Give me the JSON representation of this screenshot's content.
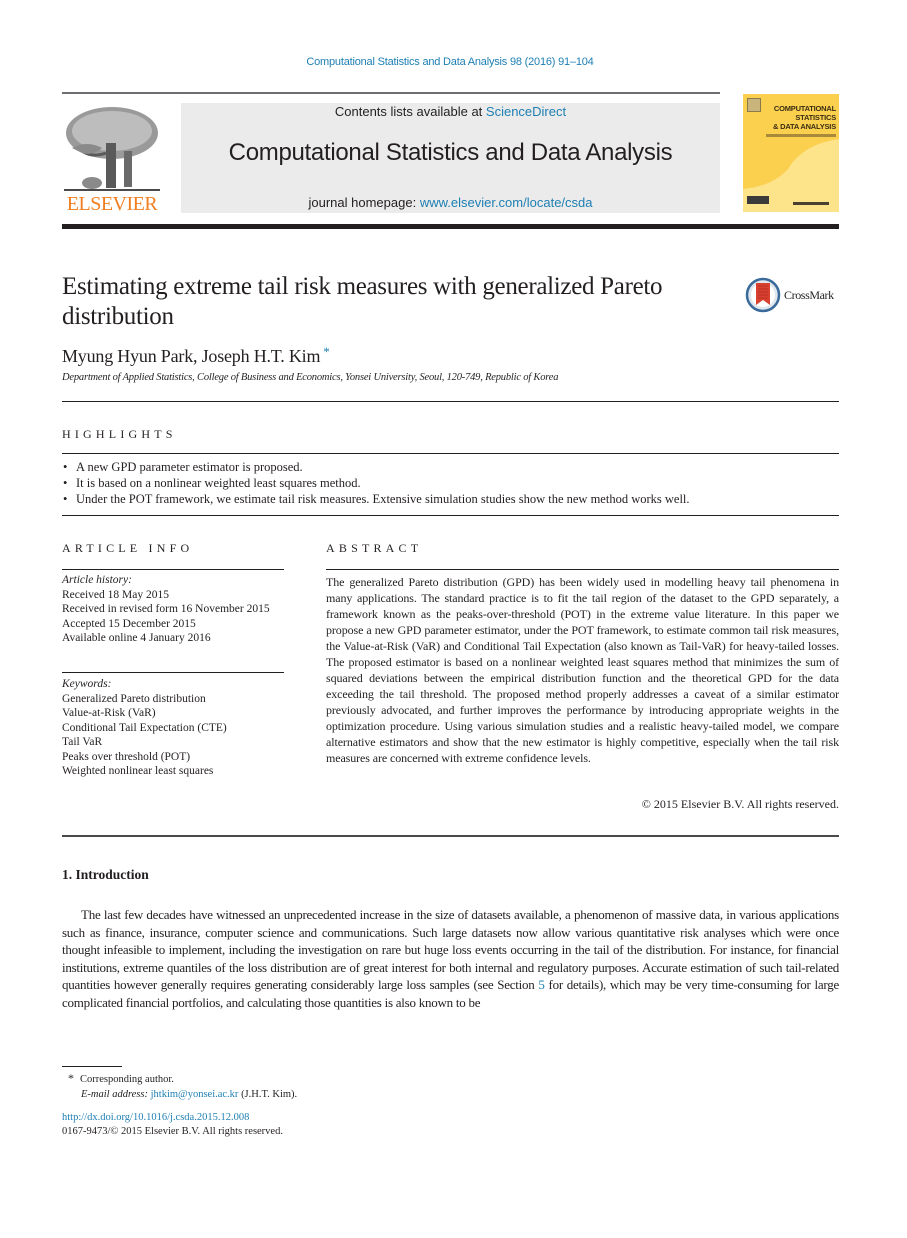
{
  "running_header": {
    "citation": "Computational Statistics and Data Analysis 98 (2016) 91–104"
  },
  "journal_banner": {
    "publisher": "ELSEVIER",
    "contents_prefix": "Contents lists available at ",
    "contents_link": "ScienceDirect",
    "journal_title": "Computational Statistics and Data Analysis",
    "homepage_prefix": "journal homepage: ",
    "homepage_link": "www.elsevier.com/locate/csda",
    "cover_title_lines": [
      "COMPUTATIONAL",
      "STATISTICS",
      "& DATA ANALYSIS"
    ],
    "cover_color": "#fbd04f"
  },
  "article": {
    "title": "Estimating extreme tail risk measures with generalized Pareto distribution",
    "crossmark_label": "CrossMark",
    "authors": "Myung Hyun Park, Joseph H.T. Kim",
    "corresponding_mark": "*",
    "affiliation": "Department of Applied Statistics, College of Business and Economics, Yonsei University, Seoul, 120-749, Republic of Korea"
  },
  "highlights": {
    "heading": "HIGHLIGHTS",
    "items": [
      "A new GPD parameter estimator is proposed.",
      "It is based on a nonlinear weighted least squares method.",
      "Under the POT framework, we estimate tail risk measures. Extensive simulation studies show the new method works well."
    ]
  },
  "article_info": {
    "heading": "ARTICLE INFO",
    "history_label": "Article history:",
    "history": [
      "Received 18 May 2015",
      "Received in revised form 16 November 2015",
      "Accepted 15 December 2015",
      "Available online 4 January 2016"
    ],
    "keywords_label": "Keywords:",
    "keywords": [
      "Generalized Pareto distribution",
      "Value-at-Risk (VaR)",
      "Conditional Tail Expectation (CTE)",
      "Tail VaR",
      "Peaks over threshold (POT)",
      "Weighted nonlinear least squares"
    ]
  },
  "abstract": {
    "heading": "ABSTRACT",
    "text": "The generalized Pareto distribution (GPD) has been widely used in modelling heavy tail phenomena in many applications. The standard practice is to fit the tail region of the dataset to the GPD separately, a framework known as the peaks-over-threshold (POT) in the extreme value literature. In this paper we propose a new GPD parameter estimator, under the POT framework, to estimate common tail risk measures, the Value-at-Risk (VaR) and Conditional Tail Expectation (also known as Tail-VaR) for heavy-tailed losses. The proposed estimator is based on a nonlinear weighted least squares method that minimizes the sum of squared deviations between the empirical distribution function and the theoretical GPD for the data exceeding the tail threshold. The proposed method properly addresses a caveat of a similar estimator previously advocated, and further improves the performance by introducing appropriate weights in the optimization procedure. Using various simulation studies and a realistic heavy-tailed model, we compare alternative estimators and show that the new estimator is highly competitive, especially when the tail risk measures are concerned with extreme confidence levels.",
    "copyright": "© 2015 Elsevier B.V. All rights reserved."
  },
  "introduction": {
    "heading": "1.  Introduction",
    "text_before_link": "The last few decades have witnessed an unprecedented increase in the size of datasets available, a phenomenon of massive data, in various applications such as finance, insurance, computer science and communications. Such large datasets now allow various quantitative risk analyses which were once thought infeasible to implement, including the investigation on rare but huge loss events occurring in the tail of the distribution. For instance, for financial institutions, extreme quantiles of the loss distribution are of great interest for both internal and regulatory purposes. Accurate estimation of such tail-related quantities however generally requires generating considerably large loss samples (see Section ",
    "section_link": "5",
    "text_after_link": " for details), which may be very time-consuming for large complicated financial portfolios, and calculating those quantities is also known to be"
  },
  "footnotes": {
    "star": "*",
    "corresponding": "Corresponding author.",
    "email_label": "E-mail address:",
    "email": "jhtkim@yonsei.ac.kr",
    "email_owner": " (J.H.T. Kim).",
    "doi": "http://dx.doi.org/10.1016/j.csda.2015.12.008",
    "issn_copyright": "0167-9473/© 2015 Elsevier B.V. All rights reserved."
  }
}
